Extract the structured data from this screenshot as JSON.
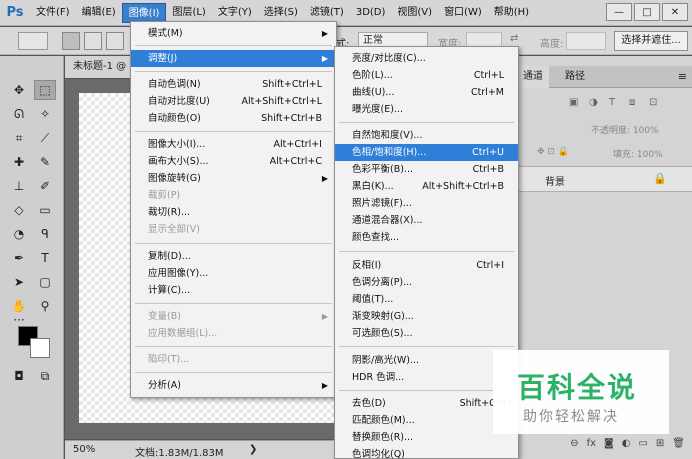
{
  "menubar": {
    "logo": "Ps",
    "items": [
      "文件(F)",
      "编辑(E)",
      "图像(I)",
      "图层(L)",
      "文字(Y)",
      "选择(S)",
      "滤镜(T)",
      "3D(D)",
      "视图(V)",
      "窗口(W)",
      "帮助(H)"
    ],
    "active_index": 2,
    "window_buttons": [
      "—",
      "□",
      "✕"
    ]
  },
  "options_bar": {
    "style_label": "式:",
    "style_value": "正常",
    "width_label": "宽度:",
    "height_label": "高度:",
    "select_button": "选择并遮住..."
  },
  "document": {
    "tab_title": "未标题-1 @",
    "zoom": "50%",
    "doc_size": "文档:1.83M/1.83M",
    "status_arrow": "❯"
  },
  "panels": {
    "tabs": [
      "通道",
      "路径"
    ],
    "opacity_label": "不透明度: 100%",
    "fill_label": "填充: 100%",
    "layer_name": "背景"
  },
  "image_menu": {
    "items": [
      {
        "label": "模式(M)",
        "shortcut": "",
        "submenu": true,
        "disabled": false
      },
      {
        "label": "调整(J)",
        "shortcut": "",
        "submenu": true,
        "disabled": false,
        "highlight": true
      },
      {
        "label": "自动色调(N)",
        "shortcut": "Shift+Ctrl+L",
        "submenu": false,
        "disabled": false
      },
      {
        "label": "自动对比度(U)",
        "shortcut": "Alt+Shift+Ctrl+L",
        "submenu": false,
        "disabled": false
      },
      {
        "label": "自动颜色(O)",
        "shortcut": "Shift+Ctrl+B",
        "submenu": false,
        "disabled": false
      },
      {
        "label": "图像大小(I)...",
        "shortcut": "Alt+Ctrl+I",
        "submenu": false,
        "disabled": false
      },
      {
        "label": "画布大小(S)...",
        "shortcut": "Alt+Ctrl+C",
        "submenu": false,
        "disabled": false
      },
      {
        "label": "图像旋转(G)",
        "shortcut": "",
        "submenu": true,
        "disabled": false
      },
      {
        "label": "裁剪(P)",
        "shortcut": "",
        "submenu": false,
        "disabled": true
      },
      {
        "label": "裁切(R)...",
        "shortcut": "",
        "submenu": false,
        "disabled": false
      },
      {
        "label": "显示全部(V)",
        "shortcut": "",
        "submenu": false,
        "disabled": true
      },
      {
        "label": "复制(D)...",
        "shortcut": "",
        "submenu": false,
        "disabled": false
      },
      {
        "label": "应用图像(Y)...",
        "shortcut": "",
        "submenu": false,
        "disabled": false
      },
      {
        "label": "计算(C)...",
        "shortcut": "",
        "submenu": false,
        "disabled": false
      },
      {
        "label": "变量(B)",
        "shortcut": "",
        "submenu": true,
        "disabled": true
      },
      {
        "label": "应用数据组(L)...",
        "shortcut": "",
        "submenu": false,
        "disabled": true
      },
      {
        "label": "陷印(T)...",
        "shortcut": "",
        "submenu": false,
        "disabled": true
      },
      {
        "label": "分析(A)",
        "shortcut": "",
        "submenu": true,
        "disabled": false
      }
    ]
  },
  "adjust_menu": {
    "items": [
      {
        "label": "亮度/对比度(C)...",
        "shortcut": ""
      },
      {
        "label": "色阶(L)...",
        "shortcut": "Ctrl+L"
      },
      {
        "label": "曲线(U)...",
        "shortcut": "Ctrl+M"
      },
      {
        "label": "曝光度(E)...",
        "shortcut": ""
      },
      {
        "label": "自然饱和度(V)...",
        "shortcut": ""
      },
      {
        "label": "色相/饱和度(H)...",
        "shortcut": "Ctrl+U",
        "highlight": true
      },
      {
        "label": "色彩平衡(B)...",
        "shortcut": "Ctrl+B"
      },
      {
        "label": "黑白(K)...",
        "shortcut": "Alt+Shift+Ctrl+B"
      },
      {
        "label": "照片滤镜(F)...",
        "shortcut": ""
      },
      {
        "label": "通道混合器(X)...",
        "shortcut": ""
      },
      {
        "label": "颜色查找...",
        "shortcut": ""
      },
      {
        "label": "反相(I)",
        "shortcut": "Ctrl+I"
      },
      {
        "label": "色调分离(P)...",
        "shortcut": ""
      },
      {
        "label": "阈值(T)...",
        "shortcut": ""
      },
      {
        "label": "渐变映射(G)...",
        "shortcut": ""
      },
      {
        "label": "可选颜色(S)...",
        "shortcut": ""
      },
      {
        "label": "阴影/高光(W)...",
        "shortcut": ""
      },
      {
        "label": "HDR 色调...",
        "shortcut": ""
      },
      {
        "label": "去色(D)",
        "shortcut": "Shift+Ctrl+"
      },
      {
        "label": "匹配颜色(M)...",
        "shortcut": ""
      },
      {
        "label": "替换颜色(R)...",
        "shortcut": ""
      },
      {
        "label": "色调均化(Q)",
        "shortcut": ""
      }
    ]
  },
  "watermark": {
    "title": "百科全说",
    "subtitle": "助你轻松解决"
  },
  "colors": {
    "highlight": "#2f7fd9",
    "watermark_green": "#2cb267"
  }
}
